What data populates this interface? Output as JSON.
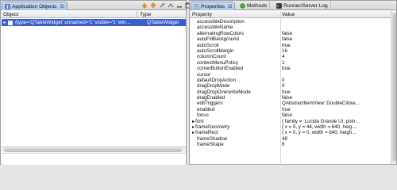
{
  "left_panel": {
    "tab_title": "Application Objects",
    "close_glyph": "☒",
    "toolbar_icons": [
      "up-arrow-icon",
      "down-arrow-icon",
      "pin-icon",
      "collapse-icon",
      "minimize-icon",
      "maximize-icon"
    ],
    "columns": {
      "object": "Object",
      "type": "Type"
    },
    "rows": [
      {
        "object": "{type='QTableWidget' unnamed='1' visible='1' win…",
        "type": "QTableWidget",
        "selected": true
      }
    ]
  },
  "right_panel": {
    "tabs": [
      {
        "label": "Properties",
        "close_glyph": "☒",
        "active": true
      },
      {
        "label": "Methods",
        "active": false
      },
      {
        "label": "Runner/Server Log",
        "active": false
      }
    ],
    "columns": {
      "property": "Property",
      "value": "Value"
    },
    "properties": [
      {
        "name": "accessibleDescription",
        "value": ""
      },
      {
        "name": "accessibleName",
        "value": ""
      },
      {
        "name": "alternatingRowColors",
        "value": "false"
      },
      {
        "name": "autoFillBackground",
        "value": "false"
      },
      {
        "name": "autoScroll",
        "value": "true"
      },
      {
        "name": "autoScrollMargin",
        "value": "16"
      },
      {
        "name": "columnCount",
        "value": "4"
      },
      {
        "name": "contextMenuPolicy",
        "value": "1"
      },
      {
        "name": "cornerButtonEnabled",
        "value": "true"
      },
      {
        "name": "cursor",
        "value": ""
      },
      {
        "name": "defaultDropAction",
        "value": "0"
      },
      {
        "name": "dragDropMode",
        "value": "0"
      },
      {
        "name": "dragDropOverwriteMode",
        "value": "true"
      },
      {
        "name": "dragEnabled",
        "value": "false"
      },
      {
        "name": "editTriggers",
        "value": "QAbstractItemView::DoubleClicke…"
      },
      {
        "name": "enabled",
        "value": "true"
      },
      {
        "name": "focus",
        "value": "false"
      },
      {
        "name": "font",
        "value": "{ family = .Lucida Grande UI, poin…",
        "expandable": true
      },
      {
        "name": "frameGeometry",
        "value": "{ x = 0, y = 44, width = 640, heig…",
        "expandable": true
      },
      {
        "name": "frameRect",
        "value": "{ x = 0, y = 0, width = 640, heigh…",
        "expandable": true
      },
      {
        "name": "frameShadow",
        "value": "48"
      },
      {
        "name": "frameShape",
        "value": "6"
      }
    ]
  }
}
